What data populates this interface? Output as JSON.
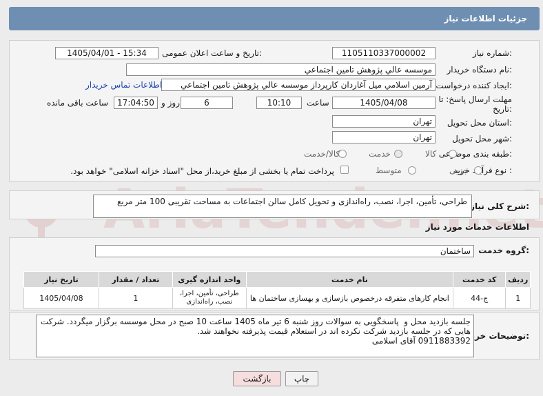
{
  "header": {
    "title": "جزئیات اطلاعات نیاز"
  },
  "form": {
    "need_number_label": "شماره نیاز:",
    "need_number": "1105110337000002",
    "announce_label": "تاریخ و ساعت اعلان عمومی:",
    "announce_value": "1405/04/01 - 15:34",
    "buyer_org_label": "نام دستگاه خریدار:",
    "buyer_org": "موسسه عالي پژوهش تامين اجتماعي",
    "requester_label": "ایجاد کننده درخواست:",
    "requester": "آرمين اسلامي ميل آغاردان کارپرداز موسسه عالي پژوهش تامين اجتماعي",
    "contact_link": "اطلاعات تماس خریدار",
    "deadline_label_1": "مهلت ارسال پاسخ: تا",
    "deadline_label_2": "تاریخ:",
    "deadline_date": "1405/04/08",
    "time_label": "ساعت",
    "deadline_time": "10:10",
    "days_value": "6",
    "days_label": "روز و",
    "remaining_time": "17:04:50",
    "remaining_label": "ساعت باقی مانده",
    "province_label": "استان محل تحویل:",
    "province": "تهران",
    "city_label": "شهر محل تحویل:",
    "city": "تهران",
    "category_label": "طبقه بندی موضوعی:",
    "category_options": [
      "کالا",
      "خدمت",
      "کالا/خدمت"
    ],
    "category_selected": "خدمت",
    "purchase_type_label": "نوع فرآیند خرید :",
    "purchase_options": [
      "جزیی",
      "متوسط"
    ],
    "payment_note": "پرداخت تمام یا بخشی از مبلغ خرید،از محل \"اسناد خزانه اسلامی\" خواهد بود."
  },
  "description": {
    "label": "شرح کلی نیاز:",
    "text": "طراحی، تأمین، اجرا، نصب، راه‌اندازی و تحویل کامل سالن اجتماعات به مساحت تقریبی 100 متر مربع"
  },
  "services": {
    "section_title": "اطلاعات خدمات مورد نیاز",
    "group_label": "گروه خدمت:",
    "group_value": "ساختمان",
    "columns": [
      "ردیف",
      "کد خدمت",
      "نام خدمت",
      "واحد اندازه گیری",
      "تعداد / مقدار",
      "تاریخ نیاز"
    ],
    "rows": [
      {
        "row": "1",
        "code": "ج-44",
        "name": "انجام کارهای متفرقه درخصوص بازسازی و بهسازی ساختمان ها",
        "unit": "طراحی، تأمین، اجرا، نصب، راه‌اندازی",
        "qty": "1",
        "date": "1405/04/08"
      }
    ]
  },
  "buyer_notes": {
    "label": "توضیحات خریدار:",
    "text": "جلسه بازدید محل و  پاسخگویی به سوالات روز شنبه 6 تیر ماه 1405 ساعت 10 صبح در محل موسسه برگزار میگردد. شرکت هایی که در جلسه بازدید شرکت نکرده اند در استعلام قیمت پذیرفته نخواهند شد.\n0911883392 آقای اسلامی"
  },
  "buttons": {
    "print": "چاپ",
    "back": "بازگشت"
  },
  "watermark": "AriaTender.net",
  "colors": {
    "header": "#6f8fb2",
    "link": "#1a3fb0",
    "back_button": "#f6dede"
  }
}
